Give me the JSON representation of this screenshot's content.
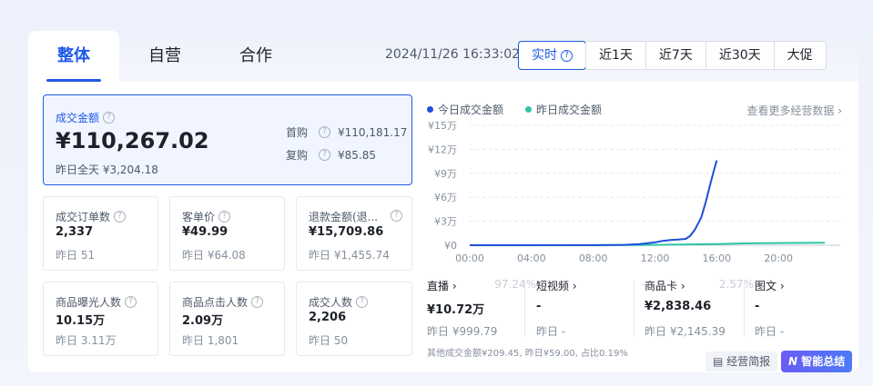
{
  "tabs": [
    {
      "label": "整体",
      "active": true
    },
    {
      "label": "自营",
      "active": false
    },
    {
      "label": "合作",
      "active": false
    }
  ],
  "timestamp": "2024/11/26 16:33:02",
  "ranges": [
    {
      "label": "实时",
      "active": true
    },
    {
      "label": "近1天"
    },
    {
      "label": "近7天"
    },
    {
      "label": "近30天"
    },
    {
      "label": "大促"
    }
  ],
  "main_metric": {
    "label": "成交金额",
    "value": "¥110,267.02",
    "yesterday": "昨日全天 ¥3,204.18",
    "first_label": "首购",
    "first_value": "¥110,181.17",
    "repeat_label": "复购",
    "repeat_value": "¥85.85"
  },
  "metrics": [
    {
      "label": "成交订单数",
      "value": "2,337",
      "yesterday": "昨日 51"
    },
    {
      "label": "客单价",
      "value": "¥49.99",
      "yesterday": "昨日 ¥64.08"
    },
    {
      "label": "退款金额(退...",
      "value": "¥15,709.86",
      "yesterday": "昨日 ¥1,455.74"
    },
    {
      "label": "商品曝光人数",
      "value": "10.15万",
      "yesterday": "昨日 3.11万"
    },
    {
      "label": "商品点击人数",
      "value": "2.09万",
      "yesterday": "昨日 1,801"
    },
    {
      "label": "成交人数",
      "value": "2,206",
      "yesterday": "昨日 50"
    }
  ],
  "more_link": "查看更多经营数据 ›",
  "colors": {
    "accent": "#1f5ae6",
    "today": "#1f4fd8",
    "yesterday": "#2ec4a6"
  },
  "chart_data": {
    "type": "line",
    "x_ticks": [
      "00:00",
      "04:00",
      "08:00",
      "12:00",
      "16:00",
      "20:00"
    ],
    "y_ticks": [
      "¥0",
      "¥3万",
      "¥6万",
      "¥9万",
      "¥12万",
      "¥15万"
    ],
    "xlim": [
      0,
      24
    ],
    "ylim": [
      0,
      150000
    ],
    "grid": true,
    "legend_position": "top-left",
    "series": [
      {
        "name": "今日成交金额",
        "color": "#1f4fd8",
        "x": [
          0,
          4,
          8,
          10,
          11,
          12,
          12.5,
          13,
          13.5,
          14,
          14.3,
          14.6,
          15,
          15.3,
          15.6,
          15.8,
          16
        ],
        "y": [
          0,
          0,
          0,
          500,
          1500,
          3500,
          5500,
          6500,
          7000,
          8000,
          12000,
          20000,
          35000,
          55000,
          78000,
          92000,
          106000
        ]
      },
      {
        "name": "昨日成交金额",
        "color": "#2ec4a6",
        "x": [
          0,
          4,
          8,
          12,
          16,
          18,
          20,
          22,
          23
        ],
        "y": [
          0,
          0,
          100,
          400,
          1500,
          2400,
          2700,
          2900,
          3200
        ]
      }
    ]
  },
  "channels": [
    {
      "name": "直播 ›",
      "pct": "97.24%",
      "value": "¥10.72万",
      "yesterday": "昨日 ¥999.79"
    },
    {
      "name": "短视频 ›",
      "pct": "-",
      "value": "-",
      "yesterday": "昨日 -"
    },
    {
      "name": "商品卡 ›",
      "pct": "2.57%",
      "value": "¥2,838.46",
      "yesterday": "昨日 ¥2,145.39"
    },
    {
      "name": "图文 ›",
      "pct": "-",
      "value": "-",
      "yesterday": "昨日 -"
    }
  ],
  "footnote": "其他成交金额¥209.45, 昨日¥59.00, 占比0.19%",
  "brief_button": "经营简报",
  "ai_button": "智能总结"
}
